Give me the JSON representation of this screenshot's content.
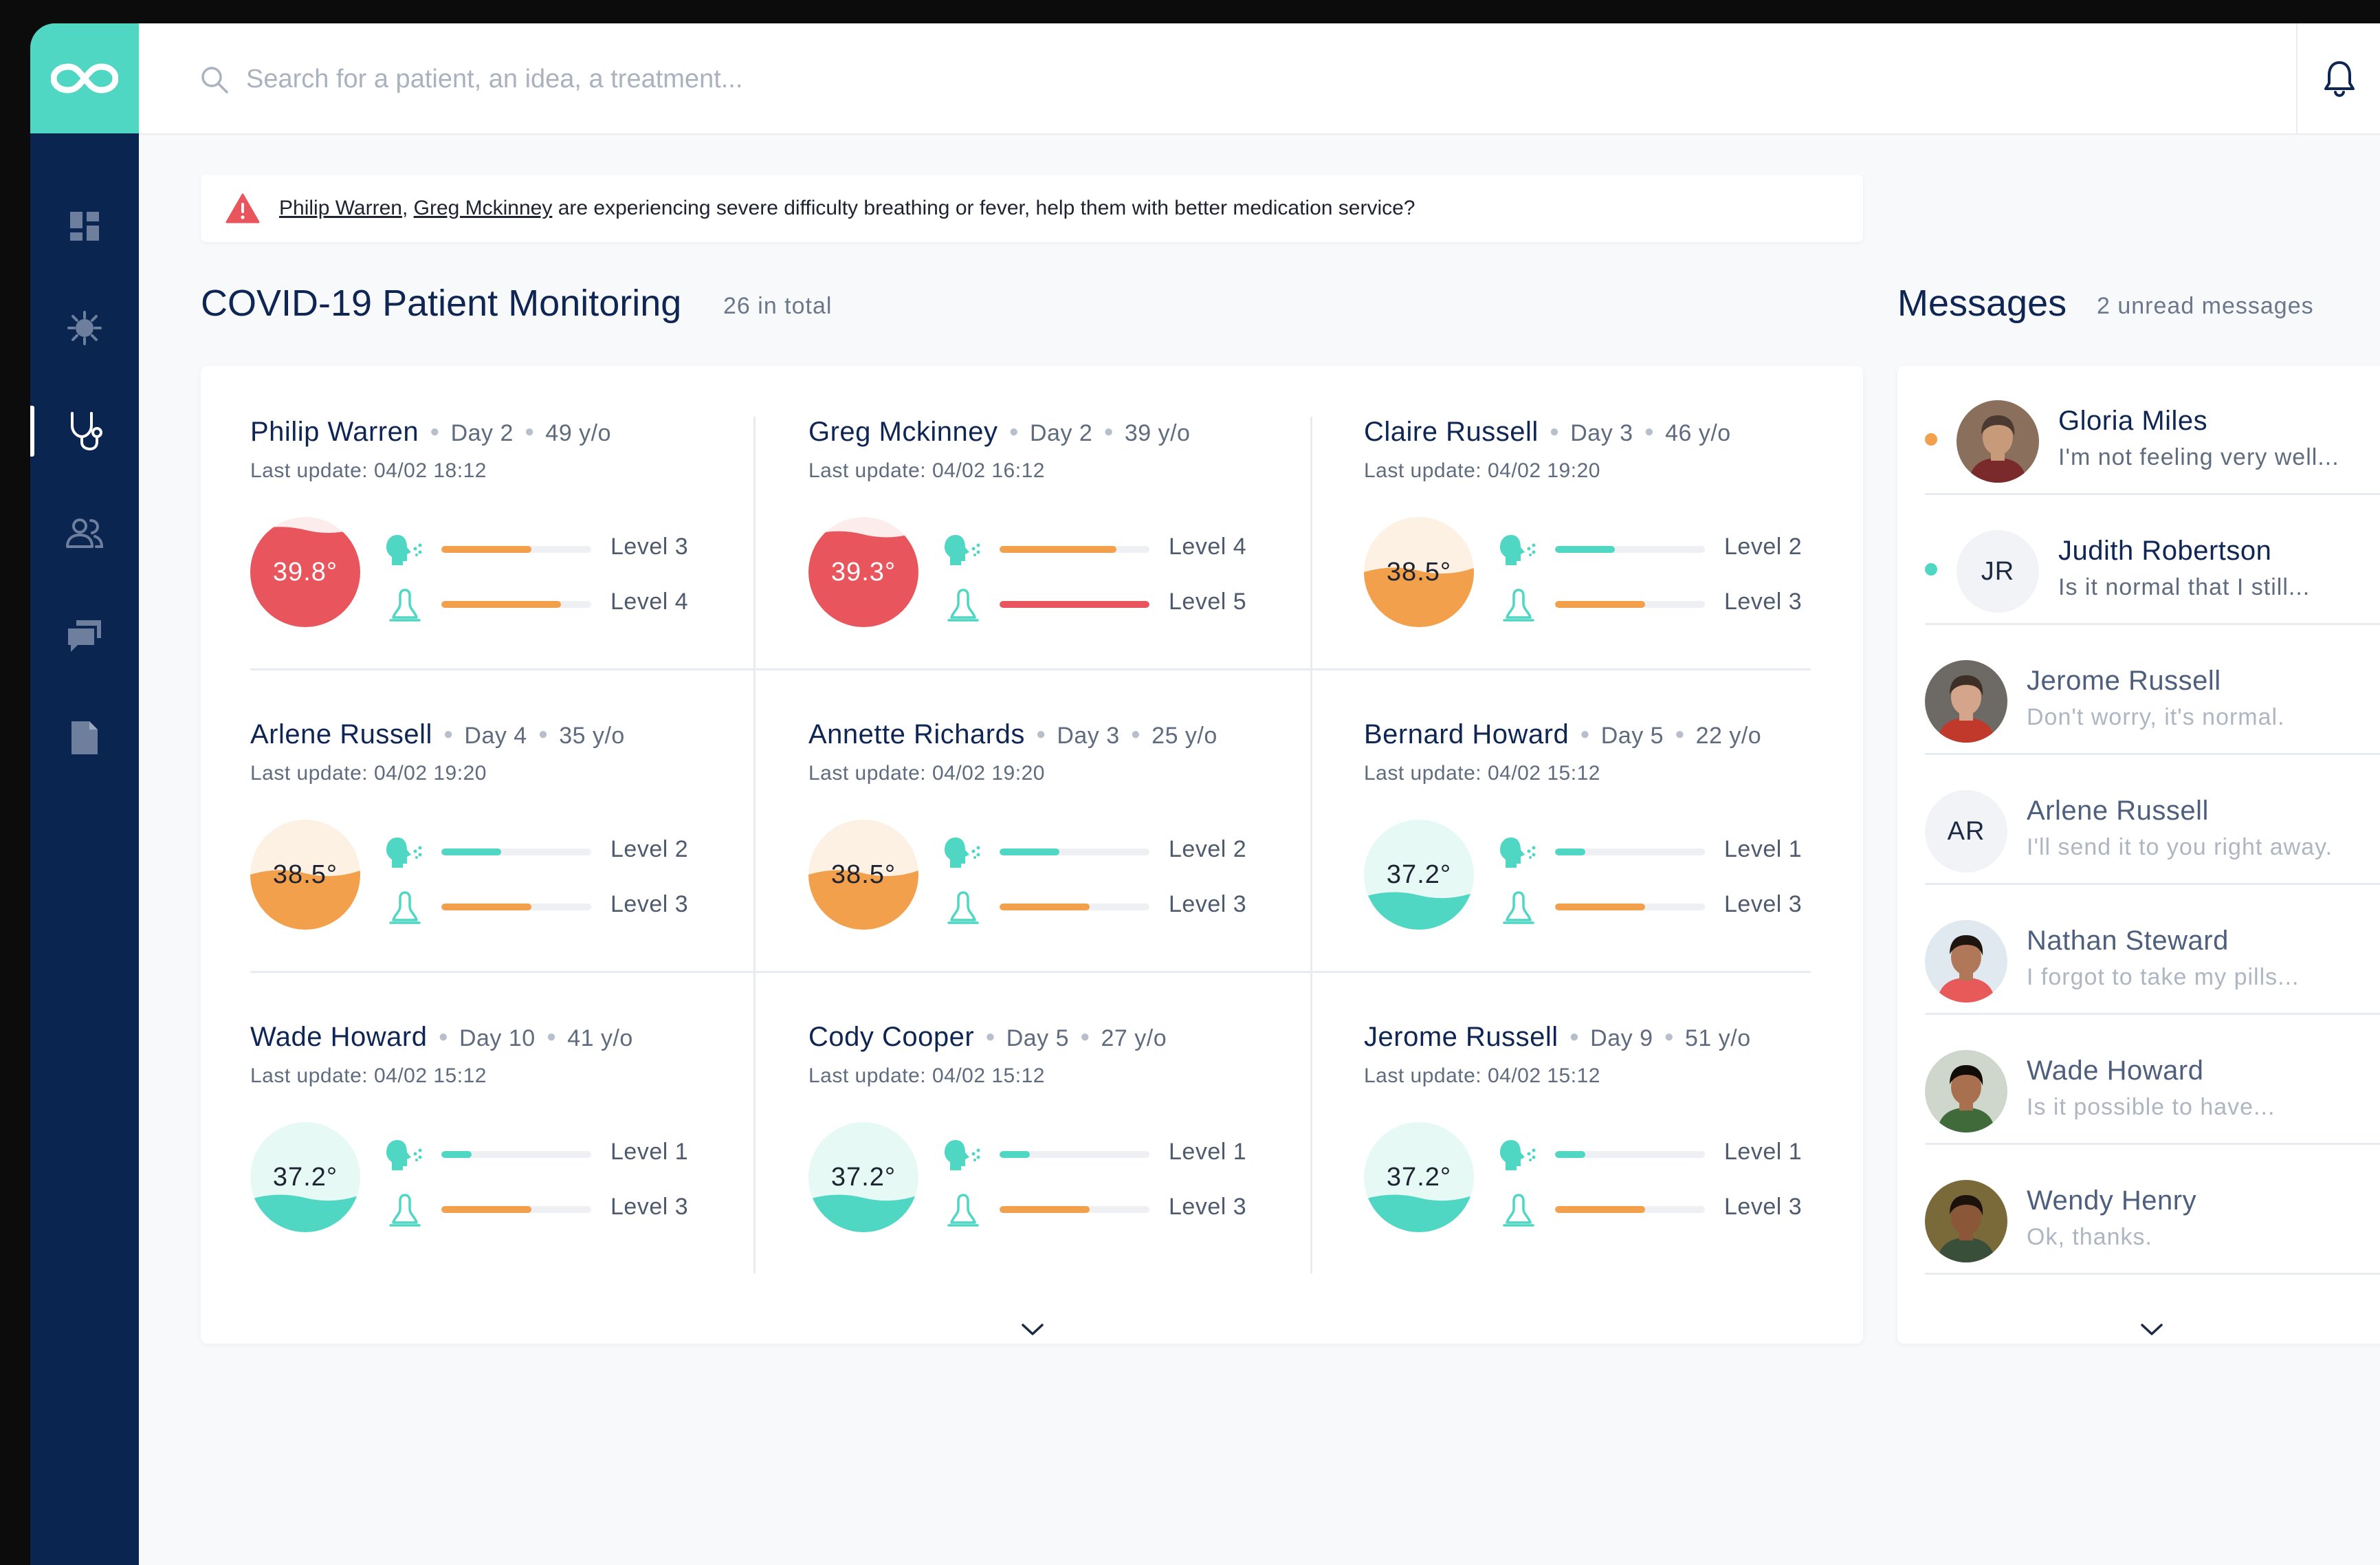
{
  "colors": {
    "sidebar": "#0b2551",
    "accent": "#4fd7c3",
    "red": "#e9555c",
    "orange": "#f2a04b",
    "teal": "#4fd7c3",
    "title": "#0f2654"
  },
  "search": {
    "placeholder": "Search for a patient, an idea, a treatment..."
  },
  "sidebar": {
    "items": [
      "dashboard-icon",
      "virus-icon",
      "stethoscope-icon",
      "users-icon",
      "chat-icon",
      "document-icon"
    ],
    "active": "stethoscope-icon"
  },
  "alert": {
    "names": [
      "Philip Warren",
      "Greg Mckinney"
    ],
    "separator": ", ",
    "message": " are experiencing severe difficulty breathing or fever, help them with better medication service?"
  },
  "patients": {
    "title": "COVID-19 Patient Monitoring",
    "count": "26 in total",
    "list": [
      {
        "name": "Philip Warren",
        "day": "Day 2",
        "age": "49 y/o",
        "update": "Last update: 04/02 18:12",
        "temp": "39.8°",
        "status": "red",
        "fill": 0.92,
        "breath_level": "Level 3",
        "breath_fill": 0.6,
        "breath_color": "orange",
        "fever_level": "Level 4",
        "fever_fill": 0.8,
        "fever_color": "orange"
      },
      {
        "name": "Greg Mckinney",
        "day": "Day 2",
        "age": "39 y/o",
        "update": "Last update: 04/02 16:12",
        "temp": "39.3°",
        "status": "red",
        "fill": 0.88,
        "breath_level": "Level 4",
        "breath_fill": 0.78,
        "breath_color": "orange",
        "fever_level": "Level 5",
        "fever_fill": 1.0,
        "fever_color": "red"
      },
      {
        "name": "Claire Russell",
        "day": "Day 3",
        "age": "46 y/o",
        "update": "Last update: 04/02 19:20",
        "temp": "38.5°",
        "status": "orange",
        "fill": 0.55,
        "breath_level": "Level 2",
        "breath_fill": 0.4,
        "breath_color": "teal",
        "fever_level": "Level 3",
        "fever_fill": 0.6,
        "fever_color": "orange"
      },
      {
        "name": "Arlene Russell",
        "day": "Day 4",
        "age": "35 y/o",
        "update": "Last update: 04/02 19:20",
        "temp": "38.5°",
        "status": "orange",
        "fill": 0.55,
        "breath_level": "Level 2",
        "breath_fill": 0.4,
        "breath_color": "teal",
        "fever_level": "Level 3",
        "fever_fill": 0.6,
        "fever_color": "orange"
      },
      {
        "name": "Annette Richards",
        "day": "Day 3",
        "age": "25 y/o",
        "update": "Last update: 04/02 19:20",
        "temp": "38.5°",
        "status": "orange",
        "fill": 0.55,
        "breath_level": "Level 2",
        "breath_fill": 0.4,
        "breath_color": "teal",
        "fever_level": "Level 3",
        "fever_fill": 0.6,
        "fever_color": "orange"
      },
      {
        "name": "Bernard Howard",
        "day": "Day 5",
        "age": "22 y/o",
        "update": "Last update: 04/02 15:12",
        "temp": "37.2°",
        "status": "teal",
        "fill": 0.35,
        "breath_level": "Level 1",
        "breath_fill": 0.2,
        "breath_color": "teal",
        "fever_level": "Level 3",
        "fever_fill": 0.6,
        "fever_color": "orange"
      },
      {
        "name": "Wade Howard",
        "day": "Day 10",
        "age": "41 y/o",
        "update": "Last update: 04/02 15:12",
        "temp": "37.2°",
        "status": "teal",
        "fill": 0.35,
        "breath_level": "Level 1",
        "breath_fill": 0.2,
        "breath_color": "teal",
        "fever_level": "Level 3",
        "fever_fill": 0.6,
        "fever_color": "orange"
      },
      {
        "name": "Cody Cooper",
        "day": "Day 5",
        "age": "27 y/o",
        "update": "Last update: 04/02 15:12",
        "temp": "37.2°",
        "status": "teal",
        "fill": 0.35,
        "breath_level": "Level 1",
        "breath_fill": 0.2,
        "breath_color": "teal",
        "fever_level": "Level 3",
        "fever_fill": 0.6,
        "fever_color": "orange"
      },
      {
        "name": "Jerome Russell",
        "day": "Day 9",
        "age": "51 y/o",
        "update": "Last update: 04/02 15:12",
        "temp": "37.2°",
        "status": "teal",
        "fill": 0.35,
        "breath_level": "Level 1",
        "breath_fill": 0.2,
        "breath_color": "teal",
        "fever_level": "Level 3",
        "fever_fill": 0.6,
        "fever_color": "orange"
      }
    ]
  },
  "messages": {
    "title": "Messages",
    "unread": "2 unread messages",
    "list": [
      {
        "name": "Gloria Miles",
        "text": "I'm not feeling very well...",
        "unread": true,
        "dot_color": "orange",
        "initials": "",
        "photo": true
      },
      {
        "name": "Judith Robertson",
        "text": "Is it normal that I still...",
        "unread": true,
        "dot_color": "teal",
        "initials": "JR",
        "photo": false
      },
      {
        "name": "Jerome Russell",
        "text": "Don't worry, it's normal.",
        "unread": false,
        "dot_color": "",
        "initials": "",
        "photo": true
      },
      {
        "name": "Arlene Russell",
        "text": "I'll send it to you right away.",
        "unread": false,
        "dot_color": "",
        "initials": "AR",
        "photo": false
      },
      {
        "name": "Nathan Steward",
        "text": "I forgot to take my pills...",
        "unread": false,
        "dot_color": "",
        "initials": "",
        "photo": true
      },
      {
        "name": "Wade Howard",
        "text": "Is it possible to have...",
        "unread": false,
        "dot_color": "",
        "initials": "",
        "photo": true
      },
      {
        "name": "Wendy Henry",
        "text": "Ok, thanks.",
        "unread": false,
        "dot_color": "",
        "initials": "",
        "photo": true
      }
    ]
  }
}
